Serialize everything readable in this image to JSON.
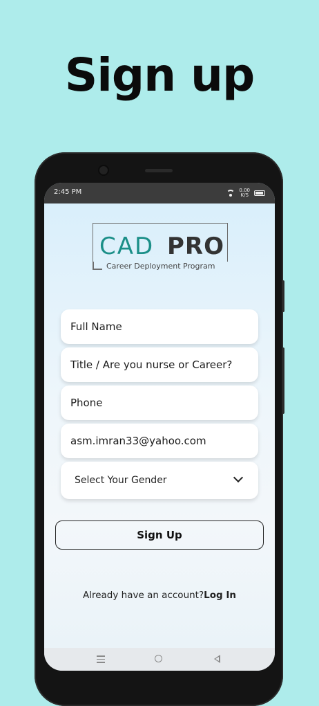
{
  "headline": "Sign up",
  "status": {
    "time": "2:45 PM",
    "net_speed_value": "0.00",
    "net_speed_unit": "K/S"
  },
  "logo": {
    "cad": "CAD",
    "pro": "PRO",
    "tagline": "Career Deployment Program"
  },
  "form": {
    "full_name": "Full Name",
    "title": "Title / Are you nurse or Career?",
    "phone": "Phone",
    "email": "asm.imran33@yahoo.com",
    "gender": "Select Your Gender",
    "submit": "Sign Up"
  },
  "footer": {
    "question": "Already have an account?",
    "login": "Log In"
  },
  "colors": {
    "background": "#aeeceb",
    "brand_teal": "#1b8f88"
  },
  "icons": [
    "wifi-icon",
    "battery-icon",
    "chevron-down-icon",
    "menu-icon",
    "home-icon",
    "back-icon"
  ]
}
